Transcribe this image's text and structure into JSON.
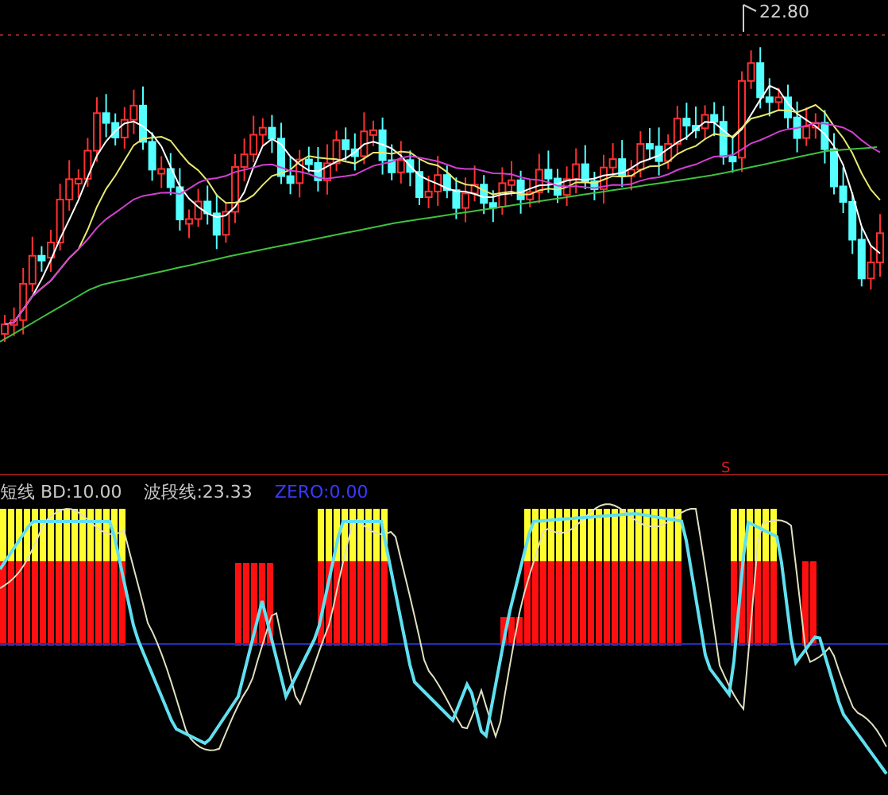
{
  "price_panel": {
    "high_label": "22.80"
  },
  "indicator_panel": {
    "legend": [
      {
        "text": "短线 BD:10.00",
        "color": "#c8c8c8"
      },
      {
        "text": "波段线:23.33",
        "color": "#c8c8c8"
      },
      {
        "text": "ZERO:0.00",
        "color": "#3a3aff"
      }
    ],
    "signal_mark": "S"
  }
}
